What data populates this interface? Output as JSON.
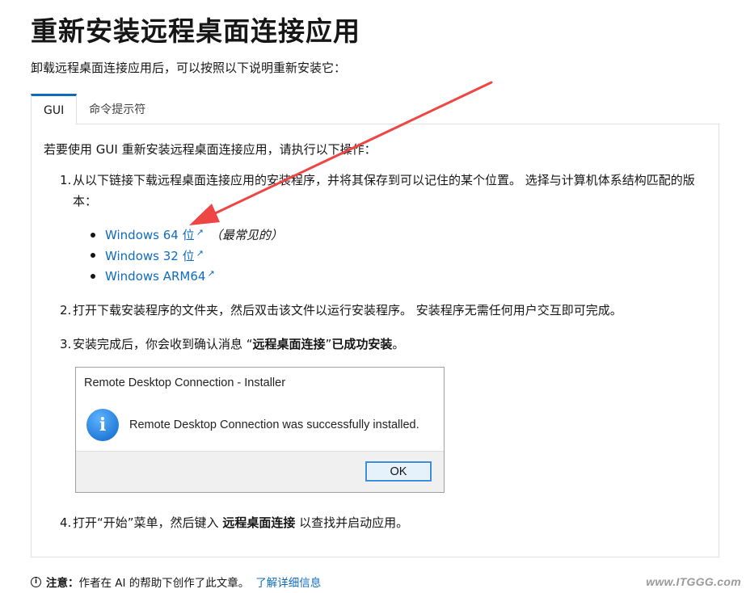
{
  "page": {
    "title": "重新安装远程桌面连接应用",
    "intro": "卸载远程桌面连接应用后，可以按照以下说明重新安装它："
  },
  "tabs": [
    {
      "label": "GUI",
      "active": true
    },
    {
      "label": "命令提示符",
      "active": false
    }
  ],
  "panel": {
    "lead": "若要使用 GUI 重新安装远程桌面连接应用，请执行以下操作：",
    "steps": {
      "s1": {
        "num": "1.",
        "text": "从以下链接下载远程桌面连接应用的安装程序，并将其保存到可以记住的某个位置。 选择与计算机体系结构匹配的版本："
      },
      "s2": {
        "num": "2.",
        "text": "打开下载安装程序的文件夹，然后双击该文件以运行安装程序。 安装程序无需任何用户交互即可完成。"
      },
      "s3": {
        "num": "3.",
        "pre": "安装完成后，你会收到确认消息 “",
        "bold1": "远程桌面连接",
        "mid": "”",
        "bold2": "已成功安装",
        "post": "。"
      },
      "s4": {
        "num": "4.",
        "pre": "打开“开始”菜单，然后键入 ",
        "bold": "远程桌面连接",
        "post": " 以查找并启动应用。"
      }
    },
    "links": [
      {
        "label": "Windows 64 位",
        "note": "（最常见的）"
      },
      {
        "label": "Windows 32 位",
        "note": ""
      },
      {
        "label": "Windows ARM64",
        "note": ""
      }
    ],
    "external_icon": "↗"
  },
  "dialog": {
    "title": "Remote Desktop Connection - Installer",
    "message": "Remote Desktop Connection was successfully installed.",
    "ok_label": "OK",
    "icon": "info-icon"
  },
  "footer": {
    "note_label": "注意：",
    "note_text": "作者在 AI 的帮助下创作了此文章。",
    "learn_more": "了解详细信息"
  },
  "watermark": "www.ITGGG.com",
  "colors": {
    "link": "#0f6cbd",
    "arrow": "#ee4545",
    "tab_accent": "#0f6cbd"
  }
}
